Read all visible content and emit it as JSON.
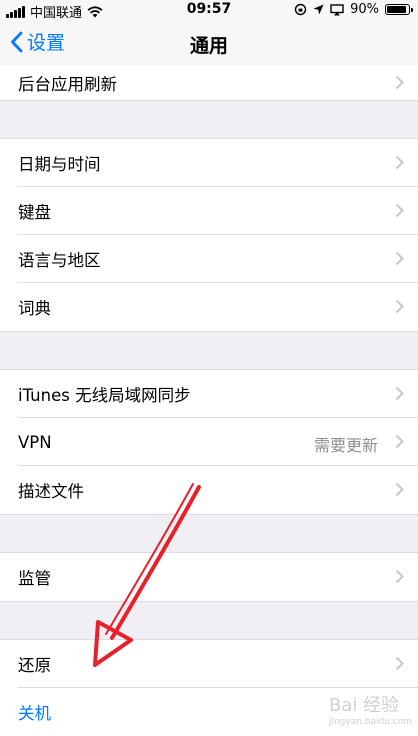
{
  "status": {
    "carrier": "中国联通",
    "time": "09:57",
    "battery": "90%",
    "battery_level": 0.9
  },
  "nav": {
    "back_label": "设置",
    "title": "通用"
  },
  "rows": {
    "bg_refresh": "后台应用刷新",
    "date_time": "日期与时间",
    "keyboard": "键盘",
    "language_region": "语言与地区",
    "dictionary": "词典",
    "itunes_sync": "iTunes 无线局域网同步",
    "vpn": "VPN",
    "vpn_detail": "需要更新",
    "profiles": "描述文件",
    "supervision": "监管",
    "reset": "还原",
    "shutdown": "关机"
  },
  "watermark": {
    "brand": "Bai 经验",
    "url": "jingyan.baidu.com"
  },
  "colors": {
    "accent": "#007aff",
    "annotation": "#e8202a"
  }
}
